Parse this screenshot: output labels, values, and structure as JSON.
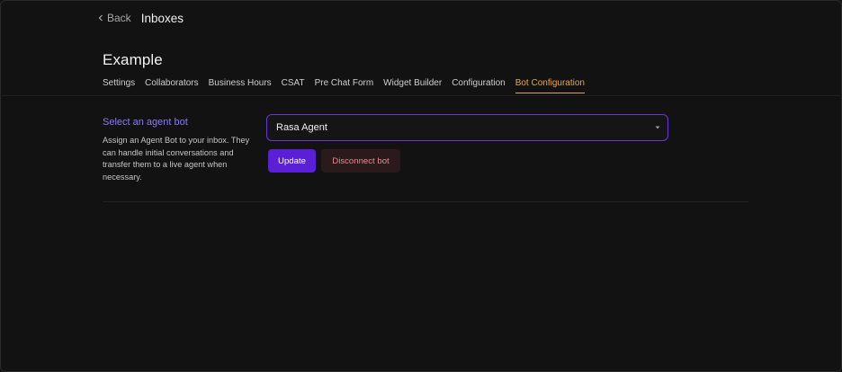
{
  "header": {
    "back_label": "Back",
    "title": "Inboxes"
  },
  "page": {
    "title": "Example"
  },
  "tabs": [
    {
      "label": "Settings",
      "active": false
    },
    {
      "label": "Collaborators",
      "active": false
    },
    {
      "label": "Business Hours",
      "active": false
    },
    {
      "label": "CSAT",
      "active": false
    },
    {
      "label": "Pre Chat Form",
      "active": false
    },
    {
      "label": "Widget Builder",
      "active": false
    },
    {
      "label": "Configuration",
      "active": false
    },
    {
      "label": "Bot Configuration",
      "active": true
    }
  ],
  "agent_bot": {
    "label": "Select an agent bot",
    "help": "Assign an Agent Bot to your inbox. They can handle initial conversations and transfer them to a live agent when necessary.",
    "selected": "Rasa Agent",
    "update_label": "Update",
    "disconnect_label": "Disconnect bot"
  },
  "colors": {
    "background": "#121212",
    "accent": "#5b1fd6",
    "active_tab": "#e2a84c",
    "label": "#8b7cf0",
    "danger_text": "#e88a8f"
  },
  "icons": {
    "back": "chevron-left-icon",
    "select": "caret-down-icon"
  }
}
